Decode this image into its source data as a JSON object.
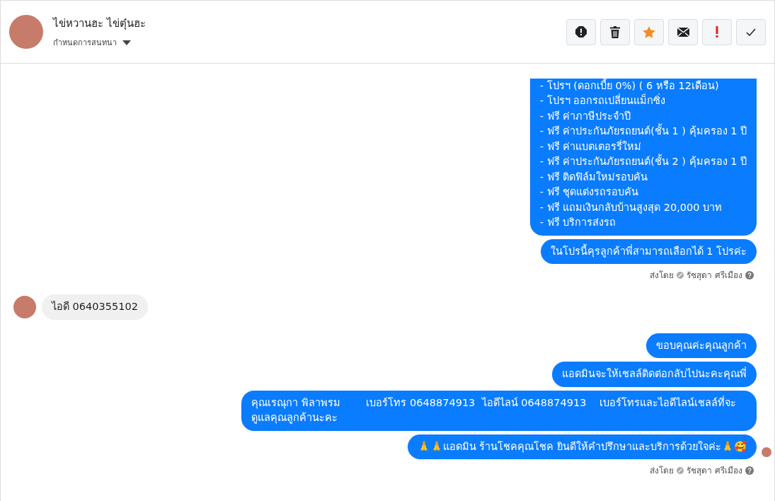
{
  "header": {
    "name": "ไข่หวานฮะ ไข่ตุ๋นฮะ",
    "subtitle": "กำหนดการสนทนา"
  },
  "actions": [
    {
      "kind": "spam"
    },
    {
      "kind": "delete"
    },
    {
      "kind": "star"
    },
    {
      "kind": "unread"
    },
    {
      "kind": "important"
    },
    {
      "kind": "done"
    }
  ],
  "messages": [
    {
      "kind": "outgoing",
      "clipped": true,
      "lines": [
        "- โปรฯ (ดอกเบี้ย 0%) ( 6 หรือ 12เดือน)",
        "- โปรฯ ออกรถเปลี่ยนแม็กซิ่ง",
        "- ฟรี ค่าภาษีประจำปี",
        "- ฟรี ค่าประกันภัยรถยนต์(ชั้น 1 ) คุ้มครอง 1 ปี",
        "- ฟรี ค่าแบตเตอรรี่ใหม่",
        "- ฟรี ค่าประกันภัยรถยนต์(ชั้น 2 ) คุ้มครอง 1 ปี",
        "- ฟรี ติดฟิล์มใหม่รอบคัน",
        "- ฟรี ชุดแต่งรถรอบคัน",
        "- ฟรี แถมเงินกลับบ้านสูงสุด 20,000 บาท",
        "- ฟรี บริการส่งรถ"
      ]
    },
    {
      "kind": "outgoing",
      "clipped": false,
      "lines": [
        "ในโปรนี้คุรลูกค้าพี่สามารถเลือกได้ 1 โปรค่ะ"
      ]
    },
    {
      "kind": "meta",
      "label": "ส่งโดย",
      "sender": "รัชสุดา ศรีเมือง"
    },
    {
      "kind": "incoming",
      "lines": [
        "ไอดี 0640355102"
      ]
    },
    {
      "kind": "outgoing",
      "clipped": false,
      "lines": [
        "ขอบคุณค่ะคุณลูกค้า"
      ]
    },
    {
      "kind": "outgoing",
      "clipped": false,
      "lines": [
        "แอดมินจะให้เชลล์ติดต่อกลับไปนะคะคุณพี่"
      ]
    },
    {
      "kind": "outgoing",
      "clipped": false,
      "lines": [
        "คุณเรณุกา พิลาพรม        เบอร์โทร 0648874913  ไอดีไลน์ 0648874913    เบอร์โทรและไอดีไลน์เชลล์ที่จะดูแลคุณลูกค้านะคะ"
      ]
    },
    {
      "kind": "outgoing",
      "clipped": false,
      "seen": true,
      "lines": [
        "🙏🙏แอดมิน ร้านโชคคุณโชค ยินดีให้คำปรึกษาและบริการด้วยใจค่ะ🙏🥰"
      ]
    },
    {
      "kind": "meta",
      "label": "ส่งโดย",
      "sender": "รัชสุดา ศรีเมือง"
    }
  ]
}
